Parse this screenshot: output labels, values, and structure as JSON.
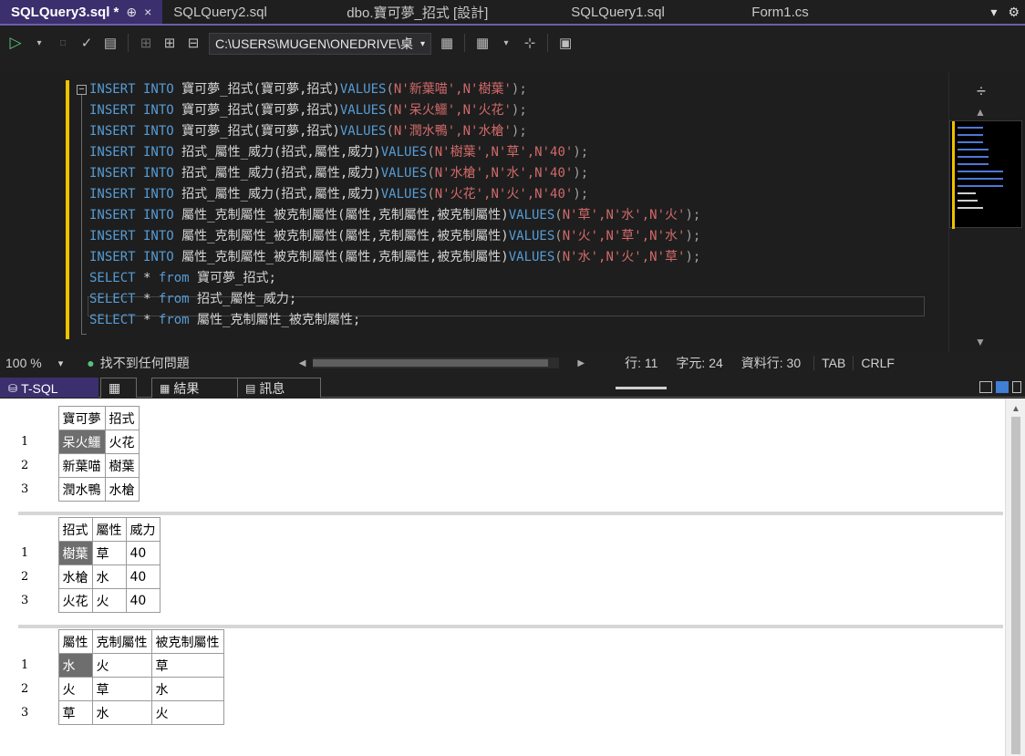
{
  "tabs": [
    {
      "label": "SQLQuery3.sql *",
      "active": true,
      "pin": "⊕",
      "close": "×"
    },
    {
      "label": "SQLQuery2.sql",
      "active": false
    },
    {
      "label": "dbo.寶可夢_招式 [設計]",
      "active": false
    },
    {
      "label": "SQLQuery1.sql",
      "active": false
    },
    {
      "label": "Form1.cs",
      "active": false
    }
  ],
  "tab_menu_icon": "dropdown-icon",
  "tab_settings_icon": "gear-icon",
  "toolbar": {
    "execute_icon": "play-icon",
    "path": "C:\\USERS\\MUGEN\\ONEDRIVE\\桌"
  },
  "editor": {
    "lines": [
      {
        "k1": "INSERT INTO",
        "t1": " 寶可夢_招式(寶可夢,招式)",
        "k2": "VALUES",
        "p": "(",
        "s": "N'新葉喵',N'樹葉'",
        "e": ");"
      },
      {
        "k1": "INSERT INTO",
        "t1": " 寶可夢_招式(寶可夢,招式)",
        "k2": "VALUES",
        "p": "(",
        "s": "N'呆火鱷',N'火花'",
        "e": ");"
      },
      {
        "k1": "INSERT INTO",
        "t1": " 寶可夢_招式(寶可夢,招式)",
        "k2": "VALUES",
        "p": "(",
        "s": "N'潤水鴨',N'水槍'",
        "e": ");"
      },
      {
        "k1": "INSERT INTO",
        "t1": " 招式_屬性_威力(招式,屬性,威力)",
        "k2": "VALUES",
        "p": "(",
        "s": "N'樹葉',N'草',N'40'",
        "e": ");"
      },
      {
        "k1": "INSERT INTO",
        "t1": " 招式_屬性_威力(招式,屬性,威力)",
        "k2": "VALUES",
        "p": "(",
        "s": "N'水槍',N'水',N'40'",
        "e": ");"
      },
      {
        "k1": "INSERT INTO",
        "t1": " 招式_屬性_威力(招式,屬性,威力)",
        "k2": "VALUES",
        "p": "(",
        "s": "N'火花',N'火',N'40'",
        "e": ");"
      },
      {
        "k1": "INSERT INTO",
        "t1": " 屬性_克制屬性_被克制屬性(屬性,克制屬性,被克制屬性)",
        "k2": "VALUES",
        "p": "(",
        "s": "N'草',N'水',N'火'",
        "e": ");"
      },
      {
        "k1": "INSERT INTO",
        "t1": " 屬性_克制屬性_被克制屬性(屬性,克制屬性,被克制屬性)",
        "k2": "VALUES",
        "p": "(",
        "s": "N'火',N'草',N'水'",
        "e": ");"
      },
      {
        "k1": "INSERT INTO",
        "t1": " 屬性_克制屬性_被克制屬性(屬性,克制屬性,被克制屬性)",
        "k2": "VALUES",
        "p": "(",
        "s": "N'水',N'火',N'草'",
        "e": ");"
      },
      {
        "k1": "SELECT",
        "t1": " * ",
        "k2": "from",
        "p": " 寶可夢_招式;",
        "s": "",
        "e": ""
      },
      {
        "k1": "SELECT",
        "t1": " * ",
        "k2": "from",
        "p": " 招式_屬性_威力;",
        "s": "",
        "e": ""
      },
      {
        "k1": "SELECT",
        "t1": " * ",
        "k2": "from",
        "p": " 屬性_克制屬性_被克制屬性;",
        "s": "",
        "e": ""
      }
    ],
    "fold_symbol": "−"
  },
  "status": {
    "zoom": "100 %",
    "issues": "找不到任何問題",
    "line": "行: 11",
    "char": "字元: 24",
    "col": "資料行: 30",
    "tab": "TAB",
    "eol": "CRLF"
  },
  "results_tabs": {
    "tsql": "T-SQL",
    "results": "結果",
    "messages": "訊息"
  },
  "results": [
    {
      "columns": [
        "寶可夢",
        "招式"
      ],
      "rows": [
        [
          "1",
          "呆火鱷",
          "火花"
        ],
        [
          "2",
          "新葉喵",
          "樹葉"
        ],
        [
          "3",
          "潤水鴨",
          "水槍"
        ]
      ]
    },
    {
      "columns": [
        "招式",
        "屬性",
        "威力"
      ],
      "rows": [
        [
          "1",
          "樹葉",
          "草",
          "40"
        ],
        [
          "2",
          "水槍",
          "水",
          "40"
        ],
        [
          "3",
          "火花",
          "火",
          "40"
        ]
      ]
    },
    {
      "columns": [
        "屬性",
        "克制屬性",
        "被克制屬性"
      ],
      "rows": [
        [
          "1",
          "水",
          "火",
          "草"
        ],
        [
          "2",
          "火",
          "草",
          "水"
        ],
        [
          "3",
          "草",
          "水",
          "火"
        ]
      ]
    }
  ]
}
